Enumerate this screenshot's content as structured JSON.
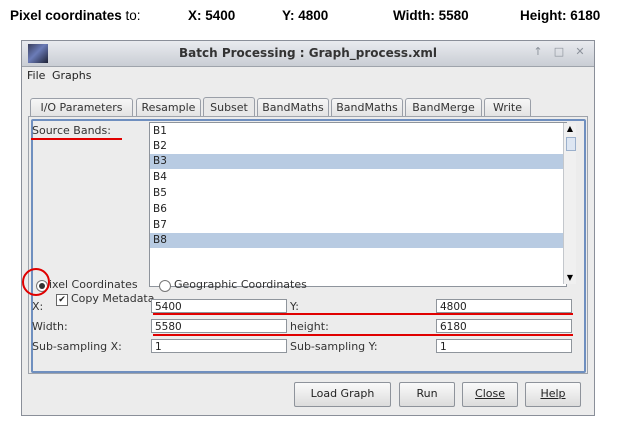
{
  "caption": {
    "label_bold": "Pixel coordinates",
    "label_rest": " to:",
    "x": "X: 5400",
    "y": "Y: 4800",
    "width": "Width: 5580",
    "height": "Height: 6180"
  },
  "window": {
    "title": "Batch Processing : Graph_process.xml",
    "controls": [
      "↑",
      "□",
      "✕"
    ]
  },
  "menu": [
    "File",
    "Graphs"
  ],
  "tabs": [
    "I/O Parameters",
    "Resample",
    "Subset",
    "BandMaths",
    "BandMaths",
    "BandMerge",
    "Write"
  ],
  "active_tab": "Subset",
  "source_bands": {
    "label": "Source Bands:",
    "items": [
      {
        "name": "B1",
        "selected": false
      },
      {
        "name": "B2",
        "selected": false
      },
      {
        "name": "B3",
        "selected": true
      },
      {
        "name": "B4",
        "selected": false
      },
      {
        "name": "B5",
        "selected": false
      },
      {
        "name": "B6",
        "selected": false
      },
      {
        "name": "B7",
        "selected": false
      },
      {
        "name": "B8",
        "selected": true
      }
    ]
  },
  "copy_metadata": {
    "label": "Copy Metadata",
    "checked": true
  },
  "coords": {
    "pixel_label": "ixel Coordinates",
    "geo_label": "Geographic Coordinates",
    "selected": "pixel"
  },
  "fields": {
    "x_label": "X:",
    "x_value": "5400",
    "y_label": "Y:",
    "y_value": "4800",
    "width_label": "Width:",
    "width_value": "5580",
    "height_label": "height:",
    "height_value": "6180",
    "subx_label": "Sub-sampling X:",
    "subx_value": "1",
    "suby_label": "Sub-sampling Y:",
    "suby_value": "1"
  },
  "buttons": {
    "load": "Load Graph",
    "run": "Run",
    "close": "Close",
    "help": "Help"
  },
  "colors": {
    "highlight": "#e00000",
    "selection": "#b8cbe2"
  }
}
